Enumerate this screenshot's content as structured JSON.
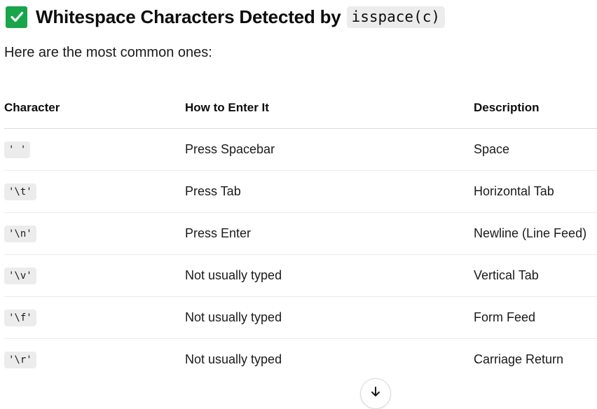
{
  "header": {
    "icon": "check-mark-button-icon",
    "title": "Whitespace Characters Detected by",
    "code": "isspace(c)"
  },
  "intro": "Here are the most common ones:",
  "table": {
    "headers": [
      "Character",
      "How to Enter It",
      "Description"
    ],
    "rows": [
      {
        "character": "' '",
        "how": "Press Spacebar",
        "description": "Space"
      },
      {
        "character": "'\\t'",
        "how": "Press Tab",
        "description": "Horizontal Tab"
      },
      {
        "character": "'\\n'",
        "how": "Press Enter",
        "description": "Newline (Line Feed)"
      },
      {
        "character": "'\\v'",
        "how": "Not usually typed",
        "description": "Vertical Tab"
      },
      {
        "character": "'\\f'",
        "how": "Not usually typed",
        "description": "Form Feed"
      },
      {
        "character": "'\\r'",
        "how": "Not usually typed",
        "description": "Carriage Return"
      }
    ]
  },
  "scroll_button": {
    "icon": "arrow-down-icon"
  },
  "colors": {
    "check_background": "#19a54a",
    "code_background": "#ececec"
  }
}
